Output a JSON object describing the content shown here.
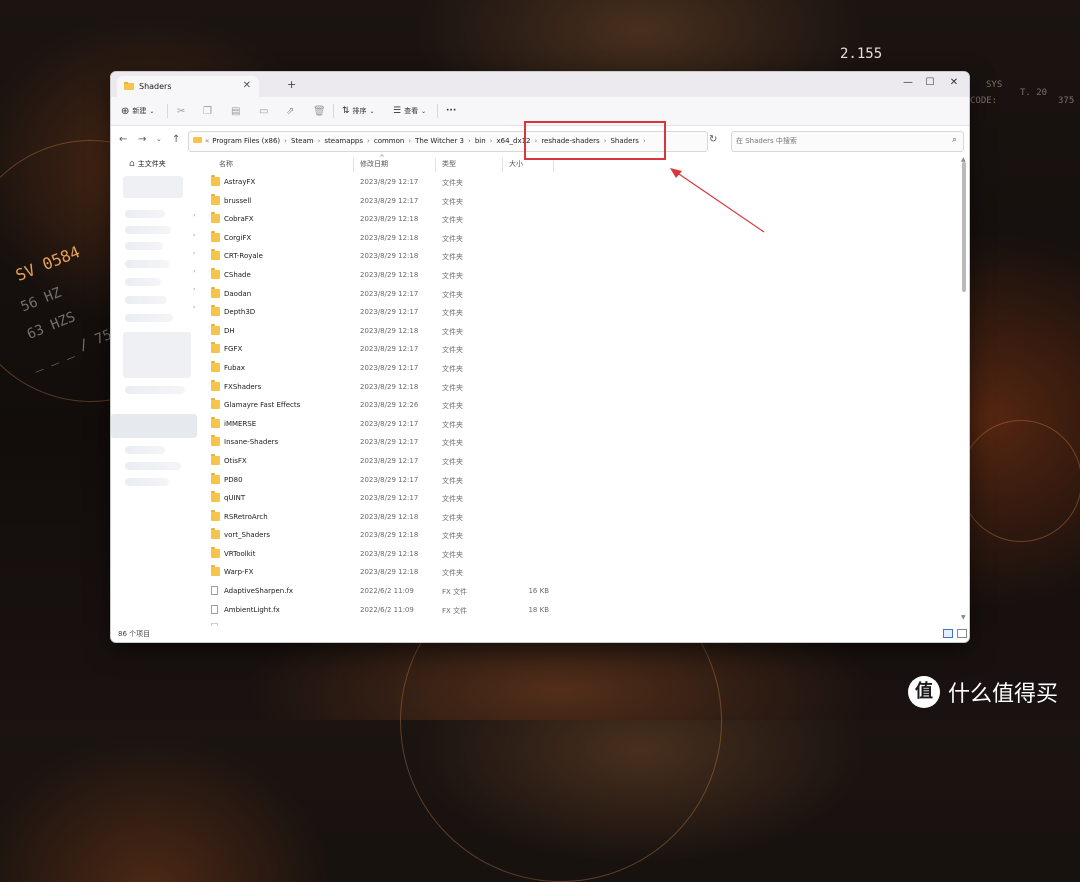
{
  "wallpaper": {
    "hud_top": "2.155",
    "hud_sv": "SV 0584",
    "hud_56": "56 HZ",
    "hud_63": "63 HZS",
    "hud_75": "_ _ _ / 75",
    "hud_sys": "SYS",
    "hud_t20": "T. 20",
    "hud_375": "375",
    "hud_code": "CODE:"
  },
  "window": {
    "tab_title": "Shaders",
    "new_tab": "+",
    "minimize": "—",
    "maximize": "☐",
    "close": "✕"
  },
  "toolbar": {
    "new_label": "新建",
    "sort_label": "排序",
    "view_label": "查看",
    "more_label": "···"
  },
  "address": {
    "crumbs": [
      "Program Files (x86)",
      "Steam",
      "steamapps",
      "common",
      "The Witcher 3",
      "bin",
      "x64_dx12",
      "reshade-shaders",
      "Shaders"
    ],
    "search_placeholder": "在 Shaders 中搜索"
  },
  "sidebar": {
    "home_label": "主文件夹"
  },
  "columns": {
    "name": "名称",
    "modified": "修改日期",
    "type": "类型",
    "size": "大小"
  },
  "files": [
    {
      "name": "AstrayFX",
      "date": "2023/8/29 12:17",
      "type": "文件夹",
      "size": "",
      "kind": "folder"
    },
    {
      "name": "brussell",
      "date": "2023/8/29 12:17",
      "type": "文件夹",
      "size": "",
      "kind": "folder"
    },
    {
      "name": "CobraFX",
      "date": "2023/8/29 12:18",
      "type": "文件夹",
      "size": "",
      "kind": "folder"
    },
    {
      "name": "CorgiFX",
      "date": "2023/8/29 12:18",
      "type": "文件夹",
      "size": "",
      "kind": "folder"
    },
    {
      "name": "CRT-Royale",
      "date": "2023/8/29 12:18",
      "type": "文件夹",
      "size": "",
      "kind": "folder"
    },
    {
      "name": "CShade",
      "date": "2023/8/29 12:18",
      "type": "文件夹",
      "size": "",
      "kind": "folder"
    },
    {
      "name": "Daodan",
      "date": "2023/8/29 12:17",
      "type": "文件夹",
      "size": "",
      "kind": "folder"
    },
    {
      "name": "Depth3D",
      "date": "2023/8/29 12:17",
      "type": "文件夹",
      "size": "",
      "kind": "folder"
    },
    {
      "name": "DH",
      "date": "2023/8/29 12:18",
      "type": "文件夹",
      "size": "",
      "kind": "folder"
    },
    {
      "name": "FGFX",
      "date": "2023/8/29 12:17",
      "type": "文件夹",
      "size": "",
      "kind": "folder"
    },
    {
      "name": "Fubax",
      "date": "2023/8/29 12:17",
      "type": "文件夹",
      "size": "",
      "kind": "folder"
    },
    {
      "name": "FXShaders",
      "date": "2023/8/29 12:18",
      "type": "文件夹",
      "size": "",
      "kind": "folder"
    },
    {
      "name": "Glamayre Fast Effects",
      "date": "2023/8/29 12:26",
      "type": "文件夹",
      "size": "",
      "kind": "folder"
    },
    {
      "name": "iMMERSE",
      "date": "2023/8/29 12:17",
      "type": "文件夹",
      "size": "",
      "kind": "folder"
    },
    {
      "name": "Insane-Shaders",
      "date": "2023/8/29 12:17",
      "type": "文件夹",
      "size": "",
      "kind": "folder"
    },
    {
      "name": "OtisFX",
      "date": "2023/8/29 12:17",
      "type": "文件夹",
      "size": "",
      "kind": "folder"
    },
    {
      "name": "PD80",
      "date": "2023/8/29 12:17",
      "type": "文件夹",
      "size": "",
      "kind": "folder"
    },
    {
      "name": "qUINT",
      "date": "2023/8/29 12:17",
      "type": "文件夹",
      "size": "",
      "kind": "folder"
    },
    {
      "name": "RSRetroArch",
      "date": "2023/8/29 12:18",
      "type": "文件夹",
      "size": "",
      "kind": "folder"
    },
    {
      "name": "vort_Shaders",
      "date": "2023/8/29 12:18",
      "type": "文件夹",
      "size": "",
      "kind": "folder"
    },
    {
      "name": "VRToolkit",
      "date": "2023/8/29 12:18",
      "type": "文件夹",
      "size": "",
      "kind": "folder"
    },
    {
      "name": "Warp-FX",
      "date": "2023/8/29 12:18",
      "type": "文件夹",
      "size": "",
      "kind": "folder"
    },
    {
      "name": "AdaptiveSharpen.fx",
      "date": "2022/6/2 11:09",
      "type": "FX 文件",
      "size": "16 KB",
      "kind": "file"
    },
    {
      "name": "AmbientLight.fx",
      "date": "2022/6/2 11:09",
      "type": "FX 文件",
      "size": "18 KB",
      "kind": "file"
    }
  ],
  "status": {
    "count": "86 个项目"
  },
  "watermark": {
    "logo": "值",
    "text": "什么值得买"
  },
  "colors": {
    "highlight": "#d9353b",
    "folder": "#f6c44b",
    "accent_orange": "#e8a156"
  }
}
